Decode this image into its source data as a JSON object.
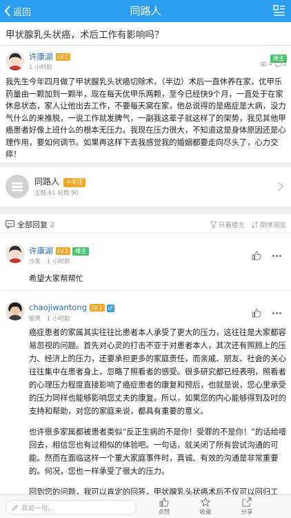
{
  "nav": {
    "back_label": "返回",
    "title": "同路人"
  },
  "thread": {
    "title": "甲状腺乳头状癌，术后工作有影响吗？"
  },
  "post": {
    "author": "许康湖",
    "level": "LV.1",
    "badge": "楼主",
    "time": "1 小时前",
    "views": "4",
    "comments": "2",
    "body": "我先生今年四月做了甲状腺乳头状癌切除术，（半边）术后一直休养在家，优甲乐药量由一颗加到一颗半，现在每天优甲乐两颗，至今已经快9个月，一直处于在家休息状态，家人让他出去工作，不要每天窝在家，他总说得的是癌症是大病，没力气什么的来推脱，一说工作就发脾气，一副我这辈子就这样了的架势，我见其他甲癌患者好像上班什么的根本无压力。我现在压力很大，不知道这是身体原因还是心理作用，要如何调节。如果再这样下去我感觉我的婚姻都要走向尽头了，心力交瘁！"
  },
  "circle": {
    "name": "同路人",
    "follow_label": "+关注",
    "stats": "主题:61 帖数:90"
  },
  "replies_header": {
    "label": "全部回复",
    "count": "2",
    "only_op": "只看楼主",
    "reverse": "倒序浏览"
  },
  "replies": [
    {
      "author": "许康湖",
      "level": "LV.1",
      "badge": "楼主",
      "floor": "沙发",
      "time": "1 小时前",
      "text": "希望大家帮帮忙"
    },
    {
      "author": "chaojiwantong",
      "level": "LV.1",
      "gender": "♂",
      "floor": "板凳",
      "time": "1 小时前",
      "paragraphs": [
        "癌症患者的家属其实往往比患者本人承受了更大的压力，这往往是大家都容易忽视的问题。首先对心灵的打击不亚于对患者本人，其次还有照顾上的压力、经济上的压力，还要承担更多的家庭责任，而亲戚、朋友、社会的关心往往集中在患者身上，忽略了照看者的感受。很多研究都已经表明，照看者的心理压力程度直接影响了癌症患者的康复和预后，也就是说，您心里承受的压力同样也能够影响您丈夫的康复。所以，如果您的内心能够得到及时的支持和帮助，对您的家庭来说，都具有重要的意义。",
        "也许很多家属都被患者类似“反正生病的不是你！受罪的不是你！”的话给噎回去，相信您也有过相似的体验吧。一句话，就关闭了所有尝试沟通的可能。然而在面临这样一个重大家庭事件时，真诚、有效的沟通是非常重要的。何况，您也一样承受了很大的压力。",
        "回到您的问题，我可以肯定的回答，甲状腺乳头状癌术后不仅可以回归工"
      ]
    }
  ],
  "bottom": {
    "input_placeholder": "我说一句...",
    "like_label": "点赞",
    "fav_label": "收藏",
    "share_label": "分享"
  },
  "colors": {
    "nav_blue": "#2b9ef0",
    "level_orange": "#f5a623",
    "op_green": "#46c46a",
    "name_blue": "#2a6db5"
  }
}
